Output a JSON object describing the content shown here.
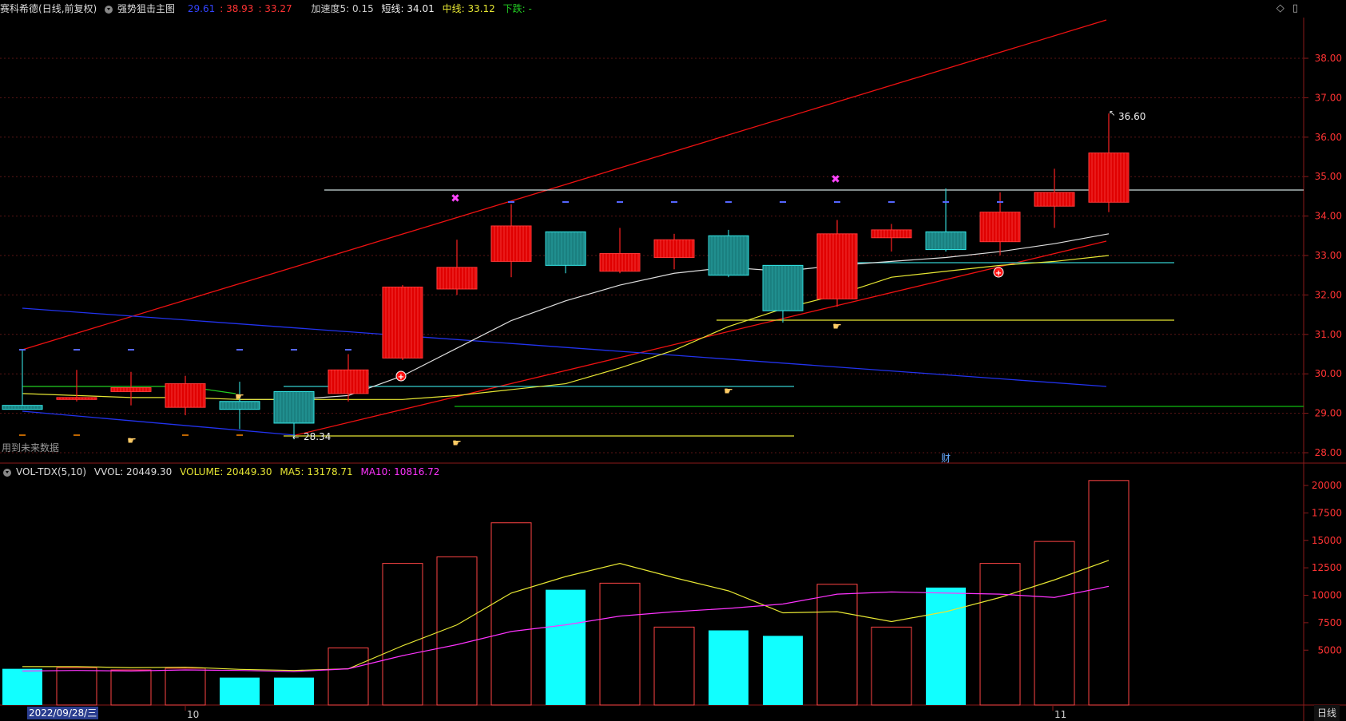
{
  "header": {
    "stock": "赛科希德",
    "period_info": "(日线,前复权)",
    "indicator": "强势狙击主图",
    "v1": "29.61",
    "v2": ": 38.93",
    "v3": ": 33.27",
    "accel": "加速度5: 0.15",
    "short": "短线: 34.01",
    "mid": "中线: 33.12",
    "down": "下跌: -"
  },
  "volume_header": {
    "name": "VOL-TDX(5,10)",
    "vvol": "VVOL: 20449.30",
    "volume": "VOLUME: 20449.30",
    "ma5": "MA5: 13178.71",
    "ma10": "MA10: 10816.72"
  },
  "notes": {
    "future_data": "用到未来数据",
    "cai": "财",
    "high_label": "36.60",
    "low_label": "28.34"
  },
  "xaxis": {
    "date_selected": "2022/09/28/三",
    "m10": "10",
    "m11": "11"
  },
  "period_button": "日线",
  "colors": {
    "up": "#ff2222",
    "down": "#33cccc",
    "ma_short": "#dddddd",
    "ma_mid": "#e6e633"
  },
  "price_axis": [
    "38.00",
    "37.00",
    "36.00",
    "35.00",
    "34.00",
    "33.00",
    "32.00",
    "31.00",
    "30.00",
    "29.00",
    "28.00"
  ],
  "vol_axis": [
    "20000",
    "17500",
    "15000",
    "12500",
    "10000",
    "7500",
    "5000"
  ],
  "candles": [
    {
      "o": 29.2,
      "c": 29.1,
      "h": 30.6,
      "l": 29.1
    },
    {
      "o": 29.35,
      "c": 29.4,
      "h": 30.1,
      "l": 29.3
    },
    {
      "o": 29.55,
      "c": 29.65,
      "h": 30.05,
      "l": 29.2
    },
    {
      "o": 29.15,
      "c": 29.75,
      "h": 29.95,
      "l": 28.95
    },
    {
      "o": 29.3,
      "c": 29.1,
      "h": 29.8,
      "l": 28.6
    },
    {
      "o": 29.55,
      "c": 28.75,
      "h": 29.55,
      "l": 28.34
    },
    {
      "o": 29.5,
      "c": 30.1,
      "h": 30.5,
      "l": 29.3
    },
    {
      "o": 30.4,
      "c": 32.2,
      "h": 32.25,
      "l": 30.35
    },
    {
      "o": 32.15,
      "c": 32.7,
      "h": 33.4,
      "l": 32.0
    },
    {
      "o": 32.85,
      "c": 33.75,
      "h": 34.3,
      "l": 32.45
    },
    {
      "o": 33.6,
      "c": 32.75,
      "h": 33.6,
      "l": 32.55
    },
    {
      "o": 32.6,
      "c": 33.05,
      "h": 33.7,
      "l": 32.55
    },
    {
      "o": 32.95,
      "c": 33.4,
      "h": 33.55,
      "l": 32.65
    },
    {
      "o": 33.5,
      "c": 32.5,
      "h": 33.65,
      "l": 32.45
    },
    {
      "o": 32.75,
      "c": 31.6,
      "h": 32.75,
      "l": 31.3
    },
    {
      "o": 31.9,
      "c": 33.55,
      "h": 33.9,
      "l": 31.7
    },
    {
      "o": 33.45,
      "c": 33.65,
      "h": 33.8,
      "l": 33.1
    },
    {
      "o": 33.6,
      "c": 33.15,
      "h": 34.7,
      "l": 33.1
    },
    {
      "o": 33.35,
      "c": 34.1,
      "h": 34.6,
      "l": 33.0
    },
    {
      "o": 34.25,
      "c": 34.6,
      "h": 35.2,
      "l": 33.7
    },
    {
      "o": 34.35,
      "c": 35.6,
      "h": 36.6,
      "l": 34.1
    }
  ],
  "ma_short": [
    null,
    null,
    null,
    null,
    29.35,
    29.35,
    29.45,
    29.95,
    30.65,
    31.35,
    31.85,
    32.25,
    32.55,
    32.7,
    32.6,
    32.75,
    32.85,
    32.95,
    33.1,
    33.3,
    33.55,
    34.0
  ],
  "ma_mid": [
    29.5,
    29.45,
    29.4,
    29.4,
    29.35,
    29.35,
    29.35,
    29.35,
    29.45,
    29.6,
    29.75,
    30.15,
    30.6,
    31.2,
    31.65,
    32.0,
    32.45,
    32.6,
    32.75,
    32.85,
    33.0,
    33.12
  ],
  "volumes": [
    3300,
    3400,
    3200,
    3350,
    2500,
    2500,
    5200,
    12900,
    13500,
    16600,
    10500,
    11100,
    7100,
    6800,
    6300,
    11000,
    7100,
    10700,
    12900,
    14900,
    20449
  ],
  "ma5_vol": [
    3500,
    3500,
    3400,
    3450,
    3250,
    3150,
    3300,
    5400,
    7300,
    10200,
    11700,
    12900,
    11600,
    10400,
    8400,
    8500,
    7600,
    8500,
    9800,
    11400,
    13178
  ],
  "ma10_vol": [
    3100,
    3150,
    3100,
    3200,
    3150,
    3050,
    3300,
    4500,
    5500,
    6700,
    7300,
    8100,
    8500,
    8800,
    9200,
    10100,
    10300,
    10200,
    10100,
    9800,
    10816
  ]
}
